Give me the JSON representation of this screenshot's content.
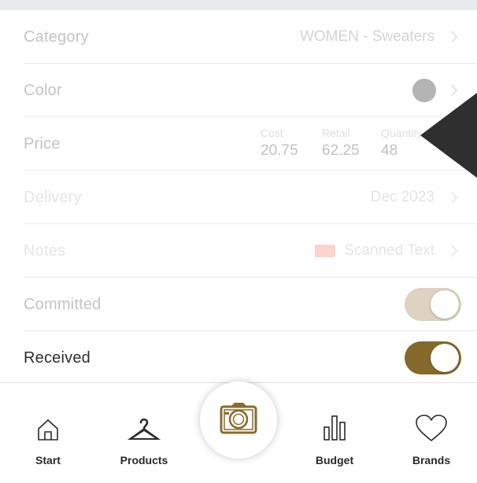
{
  "form": {
    "category": {
      "label": "Category",
      "value": "WOMEN - Sweaters"
    },
    "color": {
      "label": "Color",
      "swatch": "#b4b4b4"
    },
    "price": {
      "label": "Price",
      "cost_label": "Cost",
      "cost_value": "20.75",
      "retail_label": "Retail",
      "retail_value": "62.25",
      "quantity_label": "Quantity",
      "quantity_value": "48"
    },
    "delivery": {
      "label": "Delivery",
      "value": "Dec 2023"
    },
    "notes": {
      "label": "Notes",
      "value": "Scanned Text"
    },
    "committed": {
      "label": "Committed",
      "on": true
    },
    "received": {
      "label": "Received",
      "on": true
    }
  },
  "tabs": [
    {
      "label": "Start",
      "icon": "home-icon"
    },
    {
      "label": "Products",
      "icon": "hanger-icon"
    },
    {
      "label": "",
      "icon": "camera-icon"
    },
    {
      "label": "Budget",
      "icon": "bar-chart-icon"
    },
    {
      "label": "Brands",
      "icon": "heart-icon"
    }
  ],
  "colors": {
    "committed_toggle": "#ddd3be",
    "received_toggle": "#84692a",
    "accent_brown": "#8a6b2c",
    "pointer": "#2f2f2f"
  }
}
